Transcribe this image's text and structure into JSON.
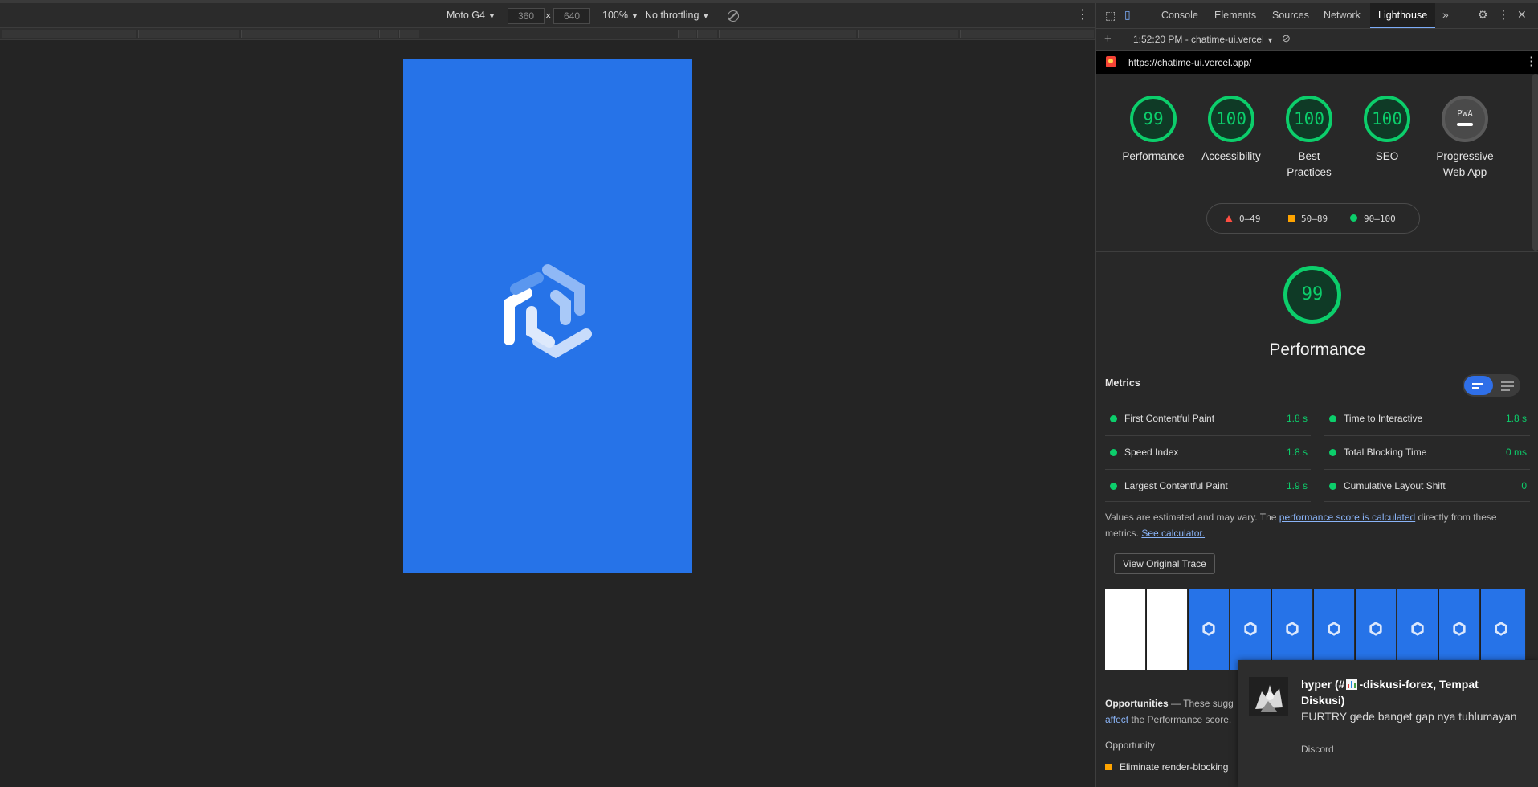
{
  "device_toolbar": {
    "device": "Moto G4",
    "width_value": "360",
    "height_value": "640",
    "times": "×",
    "zoom": "100%",
    "throttling": "No throttling"
  },
  "devtools": {
    "tabs": [
      "Console",
      "Elements",
      "Sources",
      "Network",
      "Lighthouse"
    ],
    "active_tab": "Lighthouse",
    "report_time": "1:52:20 PM - chatime-ui.vercel",
    "url": "https://chatime-ui.vercel.app/"
  },
  "categories": [
    {
      "score": "99",
      "label": "Performance"
    },
    {
      "score": "100",
      "label": "Accessibility"
    },
    {
      "score": "100",
      "label": "Best Practices"
    },
    {
      "score": "100",
      "label": "SEO"
    },
    {
      "score": "PWA",
      "label": "Progressive Web App"
    }
  ],
  "legend": {
    "fail": "0–49",
    "average": "50–89",
    "pass": "90–100"
  },
  "performance": {
    "score": "99",
    "title": "Performance",
    "metrics_heading": "Metrics",
    "metrics": [
      {
        "name": "First Contentful Paint",
        "value": "1.8 s"
      },
      {
        "name": "Time to Interactive",
        "value": "1.8 s"
      },
      {
        "name": "Speed Index",
        "value": "1.8 s"
      },
      {
        "name": "Total Blocking Time",
        "value": "0 ms"
      },
      {
        "name": "Largest Contentful Paint",
        "value": "1.9 s"
      },
      {
        "name": "Cumulative Layout Shift",
        "value": "0"
      }
    ],
    "note_prefix": "Values are estimated and may vary. The ",
    "note_link1": "performance score is calculated",
    "note_mid": " directly from these metrics. ",
    "note_link2": "See calculator.",
    "trace_button": "View Original Trace",
    "opportunities_heading": "Opportunities",
    "opportunities_text": " — These sugg",
    "opportunities_link": "affect",
    "opportunities_tail": " the Performance score.",
    "opportunity_col": "Opportunity",
    "opportunity_item": "Eliminate render-blocking"
  },
  "notification": {
    "title_prefix": "hyper (#",
    "title_suffix": "-diskusi-forex, Tempat Diskusi)",
    "message": "EURTRY gede banget gap nya tuhlumayan",
    "app": "Discord"
  },
  "colors": {
    "pass": "#0cce6b",
    "brand_blue": "#2673e8",
    "average": "#ffa400",
    "fail": "#ff4e42"
  }
}
